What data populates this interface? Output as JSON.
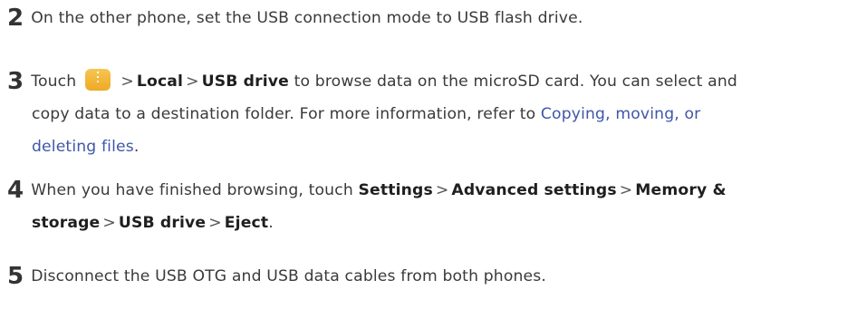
{
  "steps": [
    {
      "number": "2",
      "lines": [
        {
          "text": "On the other phone, set the USB connection mode to USB flash drive."
        }
      ]
    },
    {
      "number": "3",
      "touch": "Touch",
      "icon": "file-manager-icon",
      "sep": ">",
      "local": "Local",
      "usb_drive": "USB drive",
      "rest": "to browse data on the microSD card. You can select and",
      "line2_pre": "copy data to a destination folder. For more information, refer to",
      "link_part1": "Copying, moving, or",
      "link_part2": "deleting files",
      "line3_end": "."
    },
    {
      "number": "4",
      "pre": "When you have finished browsing, touch",
      "settings": "Settings",
      "sep": ">",
      "advanced": "Advanced settings",
      "memory": "Memory &",
      "storage": "storage",
      "usb_drive": "USB drive",
      "eject": "Eject",
      "end": "."
    },
    {
      "number": "5",
      "text": "Disconnect the USB OTG and USB data cables from both phones."
    }
  ]
}
